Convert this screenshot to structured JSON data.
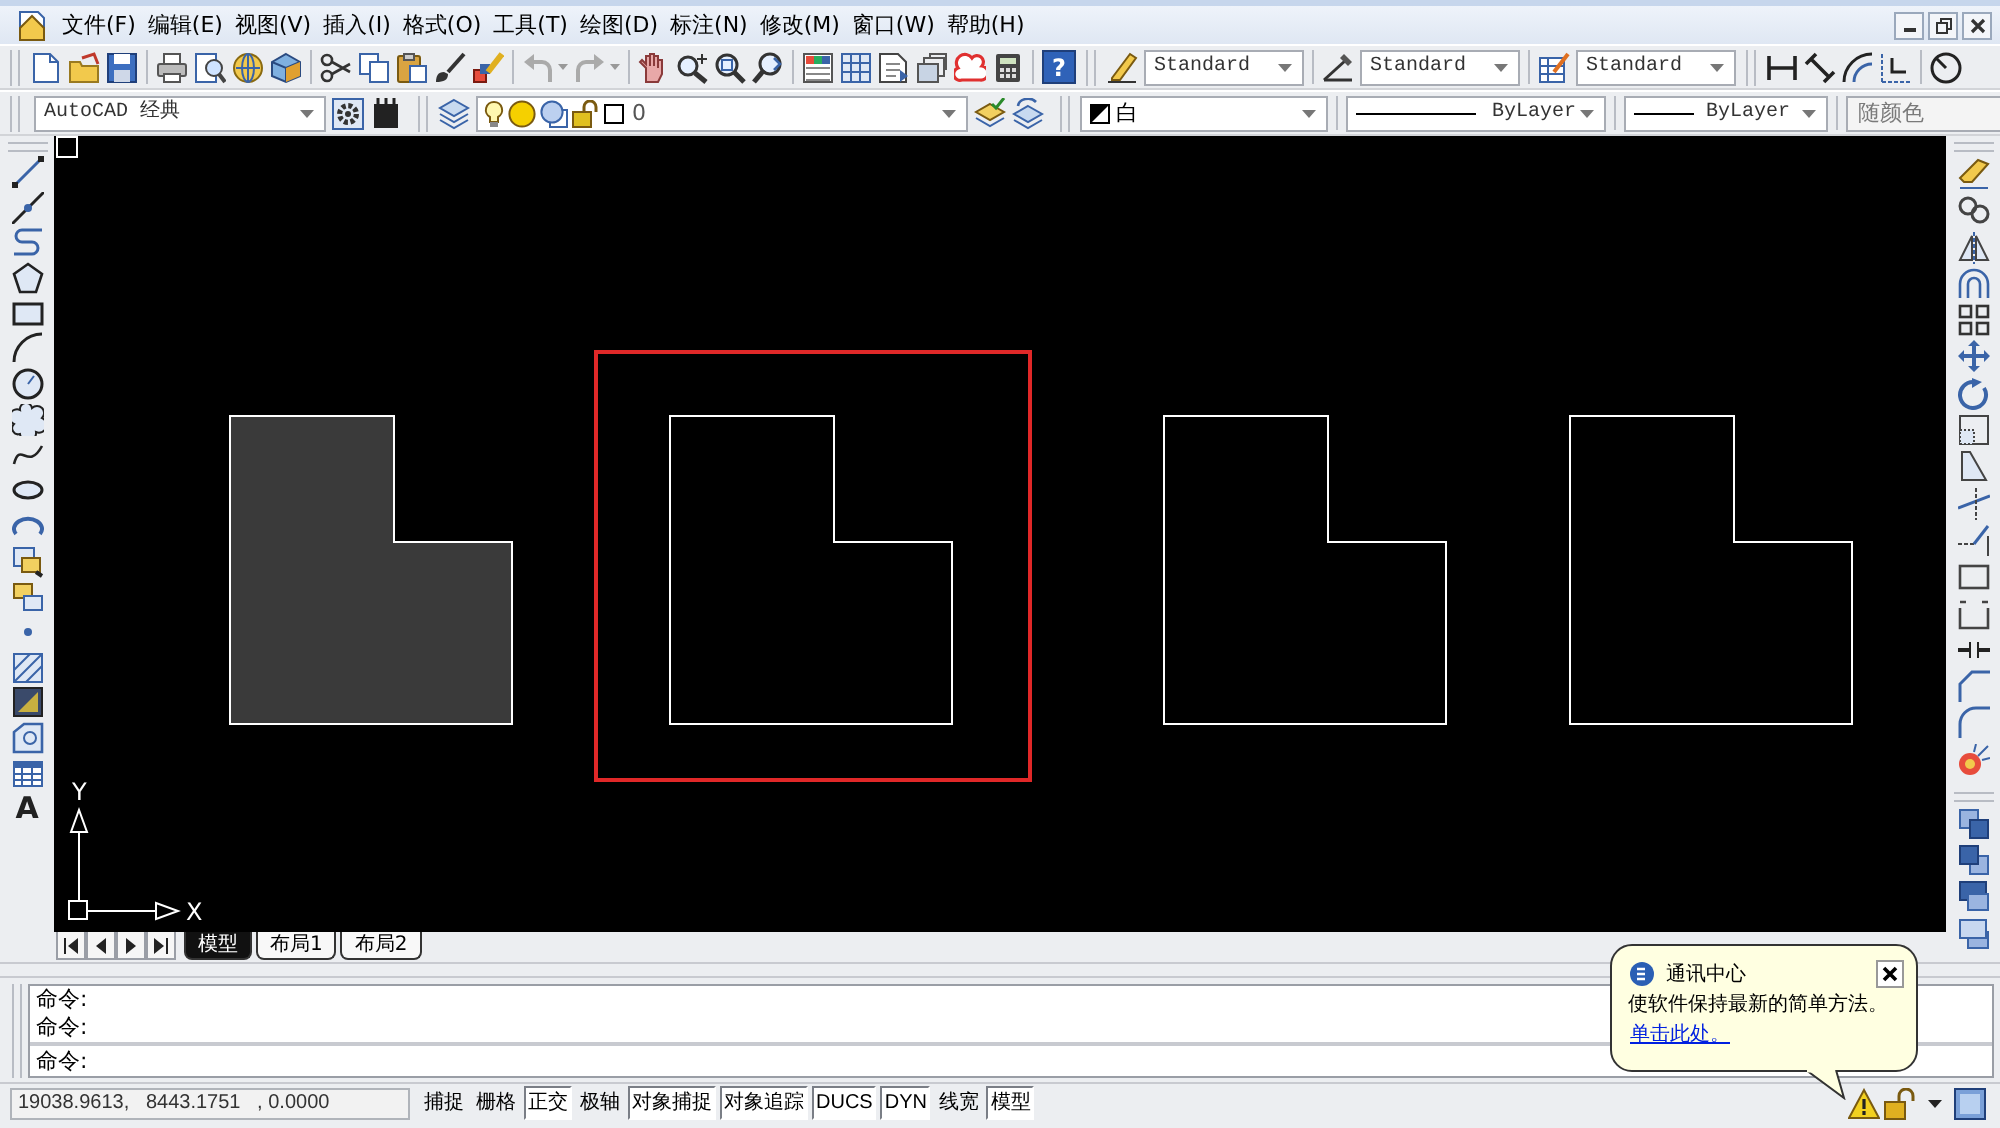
{
  "menu_bar": {
    "items": [
      "文件(F)",
      "编辑(E)",
      "视图(V)",
      "插入(I)",
      "格式(O)",
      "工具(T)",
      "绘图(D)",
      "标注(N)",
      "修改(M)",
      "窗口(W)",
      "帮助(H)"
    ]
  },
  "standard_toolbar": {
    "help_label": "?",
    "text_style": "Standard",
    "dimension_style": "Standard",
    "table_style": "Standard"
  },
  "properties_toolbar": {
    "workspace": "AutoCAD 经典",
    "layer": "0",
    "color_setting": "白",
    "linetype": "ByLayer",
    "lineweight": "ByLayer",
    "plot_style": {
      "value": "随颜色",
      "disabled": true
    }
  },
  "draw_toolbar": {
    "text_tool_label": "A"
  },
  "canvas": {
    "shapes": [
      {
        "kind": "filled",
        "highlighted": false
      },
      {
        "kind": "outline",
        "highlighted": true
      },
      {
        "kind": "outline",
        "highlighted": false
      },
      {
        "kind": "outline",
        "highlighted": false
      }
    ],
    "ucs": {
      "y_label": "Y",
      "x_label": "X"
    }
  },
  "layout_tabs": [
    {
      "label": "模型",
      "selected": true
    },
    {
      "label": "布局1",
      "selected": false
    },
    {
      "label": "布局2",
      "selected": false
    }
  ],
  "command_window": {
    "history": [
      "命令:",
      "命令:"
    ],
    "prompt": "命令:"
  },
  "status_bar": {
    "coordinates": "19038.9613,   8443.1751   , 0.0000",
    "toggles": [
      {
        "label": "捕捉",
        "on": false
      },
      {
        "label": "栅格",
        "on": false
      },
      {
        "label": "正交",
        "on": true
      },
      {
        "label": "极轴",
        "on": false
      },
      {
        "label": "对象捕捉",
        "on": true
      },
      {
        "label": "对象追踪",
        "on": true
      },
      {
        "label": "DUCS",
        "on": true
      },
      {
        "label": "DYN",
        "on": true
      },
      {
        "label": "线宽",
        "on": false
      },
      {
        "label": "模型",
        "on": true
      }
    ]
  },
  "notification": {
    "title": "通讯中心",
    "message": "使软件保持最新的简单方法。",
    "link": "单击此处。"
  }
}
